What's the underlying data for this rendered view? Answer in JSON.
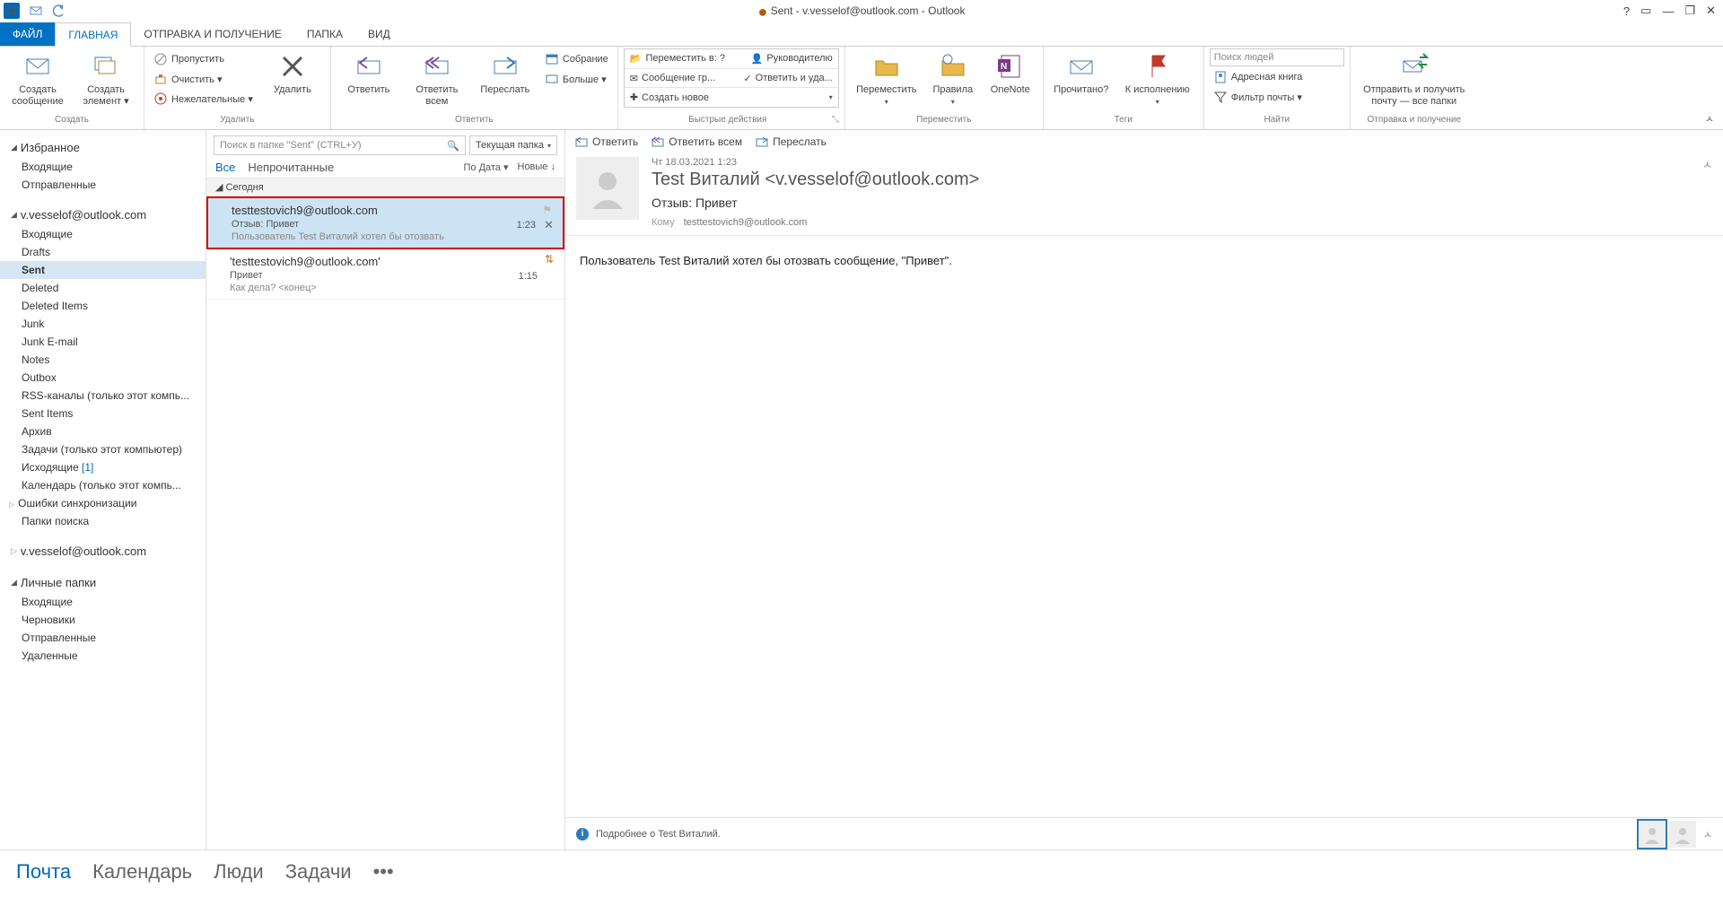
{
  "window": {
    "title": "Sent - v.vesselof@outlook.com - Outlook"
  },
  "tabs": {
    "file": "ФАЙЛ",
    "home": "ГЛАВНАЯ",
    "sendrecv": "ОТПРАВКА И ПОЛУЧЕНИЕ",
    "folder": "ПАПКА",
    "view": "ВИД"
  },
  "ribbon": {
    "new_mail": "Создать сообщение",
    "new_items": "Создать элемент ▾",
    "ignore": "Пропустить",
    "clean": "Очистить ▾",
    "junk": "Нежелательные ▾",
    "delete": "Удалить",
    "reply": "Ответить",
    "reply_all": "Ответить всем",
    "forward": "Переслать",
    "meeting": "Собрание",
    "more": "Больше ▾",
    "move_to": "Переместить в: ?",
    "to_manager": "Руководителю",
    "team_msg": "Сообщение гр...",
    "reply_del": "Ответить и уда...",
    "create_new": "Создать новое",
    "move": "Переместить",
    "rules": "Правила",
    "onenote": "OneNote",
    "read": "Прочитано?",
    "followup": "К исполнению",
    "search_people_ph": "Поиск людей",
    "addr_book": "Адресная книга",
    "filter": "Фильтр почты ▾",
    "sendrecv_all": "Отправить и получить почту — все папки",
    "g_create": "Создать",
    "g_delete": "Удалить",
    "g_reply": "Ответить",
    "g_quick": "Быстрые действия",
    "g_move": "Переместить",
    "g_tags": "Теги",
    "g_find": "Найти",
    "g_sr": "Отправка и получение"
  },
  "nav": {
    "h_fav": "Избранное",
    "fav_inbox": "Входящие",
    "fav_sent": "Отправленные",
    "acct1": "v.vesselof@outlook.com",
    "a1": [
      "Входящие",
      "Drafts",
      "Sent",
      "Deleted",
      "Deleted Items",
      "Junk",
      "Junk E-mail",
      "Notes",
      "Outbox",
      "RSS-каналы (только этот компь...",
      "Sent Items",
      "Архив",
      "Задачи (только этот компьютер)",
      "Исходящие",
      "Календарь (только этот компь...",
      "Ошибки синхронизации",
      "Папки поиска"
    ],
    "outgoing_count": "[1]",
    "acct2": "v.vesselof@outlook.com",
    "h_personal": "Личные папки",
    "p": [
      "Входящие",
      "Черновики",
      "Отправленные",
      "Удаленные"
    ]
  },
  "list": {
    "search_ph": "Поиск в папке \"Sent\" (CTRL+У)",
    "scope": "Текущая папка",
    "f_all": "Все",
    "f_unread": "Непрочитанные",
    "sort": "По Дата ▾",
    "newest": "Новые ↓",
    "grp_today": "Сегодня",
    "msgs": [
      {
        "from": "testtestovich9@outlook.com",
        "subj": "Отзыв: Привет",
        "prev": "Пользователь Test Виталий хотел бы отозвать",
        "time": "1:23"
      },
      {
        "from": "'testtestovich9@outlook.com'",
        "subj": "Привет",
        "prev": "Как дела?  <конец>",
        "time": "1:15"
      }
    ]
  },
  "reading": {
    "a_reply": "Ответить",
    "a_reply_all": "Ответить всем",
    "a_forward": "Переслать",
    "date": "Чт 18.03.2021 1:23",
    "from": "Test Виталий <v.vesselof@outlook.com>",
    "subject": "Отзыв: Привет",
    "to_lbl": "Кому",
    "to": "testtestovich9@outlook.com",
    "body": "Пользователь Test Виталий хотел бы отозвать сообщение, \"Привет\".",
    "footer": "Подробнее о Test Виталий."
  },
  "bottom": {
    "mail": "Почта",
    "cal": "Календарь",
    "people": "Люди",
    "tasks": "Задачи"
  }
}
